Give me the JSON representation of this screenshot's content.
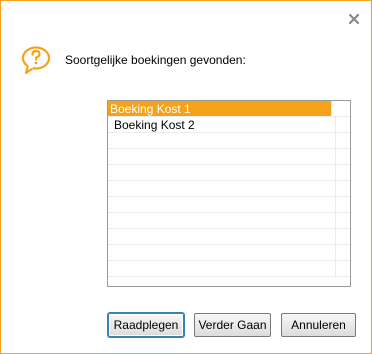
{
  "dialog": {
    "close_icon": "close-icon",
    "question_icon": "question-bubble-icon",
    "message": "Soortgelijke boekingen gevonden:",
    "accent_color": "#f5a21a"
  },
  "list": {
    "items": [
      {
        "label": "Boeking Kost 1",
        "selected": true
      },
      {
        "label": "Boeking Kost 2",
        "selected": false
      },
      {
        "label": "",
        "selected": false
      },
      {
        "label": "",
        "selected": false
      },
      {
        "label": "",
        "selected": false
      },
      {
        "label": "",
        "selected": false
      },
      {
        "label": "",
        "selected": false
      },
      {
        "label": "",
        "selected": false
      },
      {
        "label": "",
        "selected": false
      },
      {
        "label": "",
        "selected": false
      },
      {
        "label": "",
        "selected": false
      }
    ]
  },
  "buttons": {
    "raadplegen": "Raadplegen",
    "verder_gaan": "Verder Gaan",
    "annuleren": "Annuleren"
  }
}
